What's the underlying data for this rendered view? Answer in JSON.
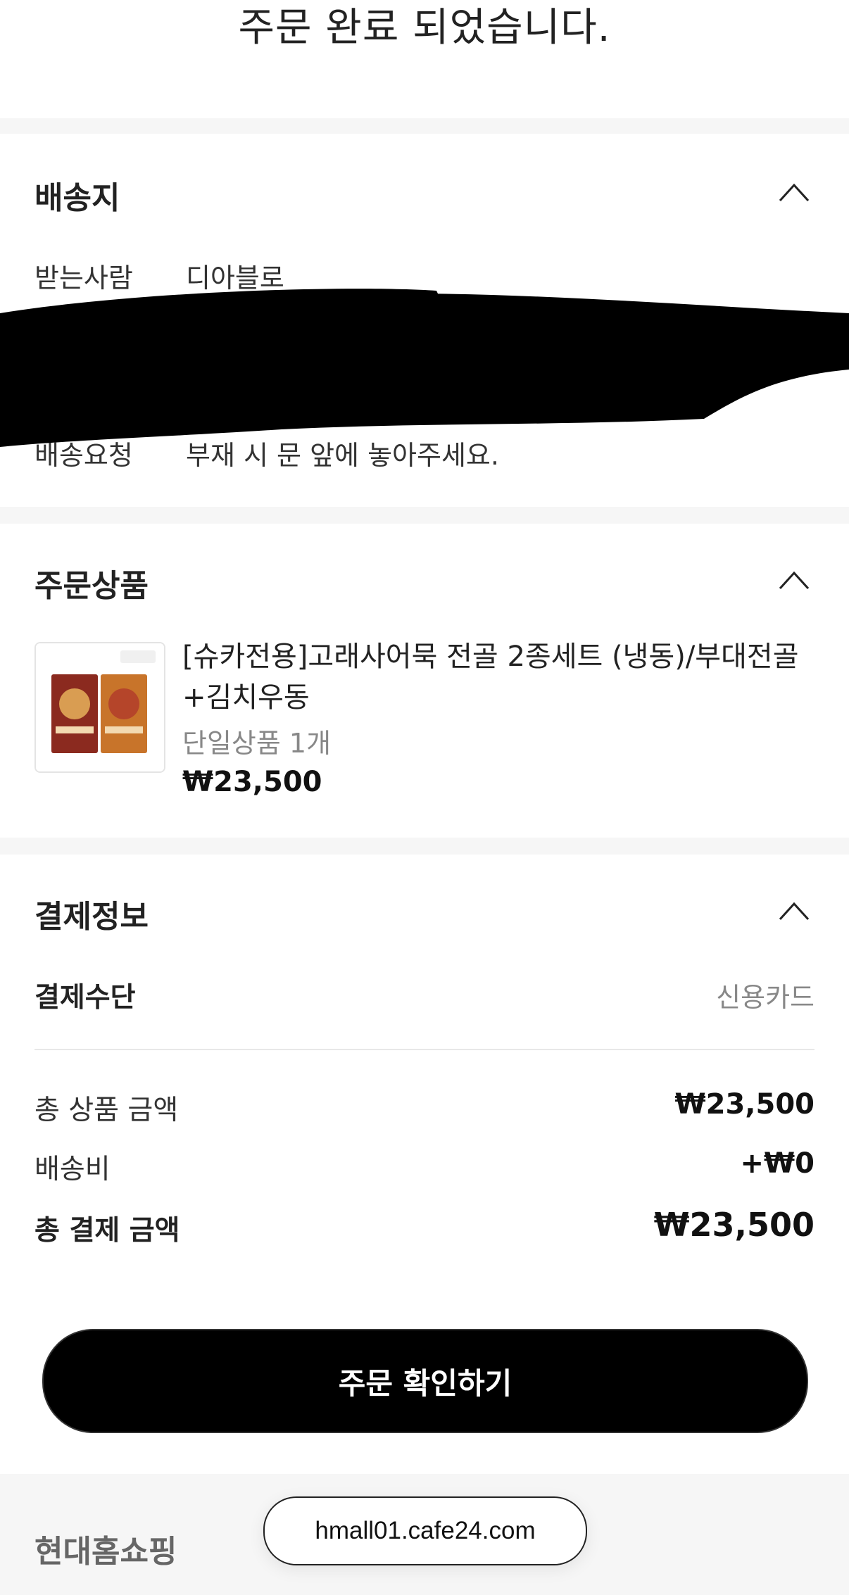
{
  "page": {
    "title": "주문 완료 되었습니다."
  },
  "shipping": {
    "title": "배송지",
    "fields": [
      {
        "label": "받는사람",
        "value": "디아블로"
      },
      {
        "label": "배송요청",
        "value": "부재 시 문 앞에 놓아주세요."
      }
    ]
  },
  "products": {
    "title": "주문상품",
    "item": {
      "name": "[슈카전용]고래사어묵 전골 2종세트 (냉동)/부대전골 +김치우동",
      "option": "단일상품 1개",
      "price": "₩23,500"
    }
  },
  "payment": {
    "title": "결제정보",
    "method_label": "결제수단",
    "method_value": "신용카드",
    "rows": [
      {
        "label": "총 상품 금액",
        "value": "₩23,500"
      },
      {
        "label": "배송비",
        "value": "+₩0"
      }
    ],
    "total_label": "총 결제 금액",
    "total_value": "₩23,500"
  },
  "actions": {
    "confirm_label": "주문 확인하기"
  },
  "footer": {
    "brand": "현대홈쇼핑"
  },
  "browser": {
    "url": "hmall01.cafe24.com"
  },
  "colors": {
    "button_bg": "#000000",
    "section_gap": "#f6f6f6"
  },
  "icons": {
    "collapse": "chevron-up-icon"
  }
}
